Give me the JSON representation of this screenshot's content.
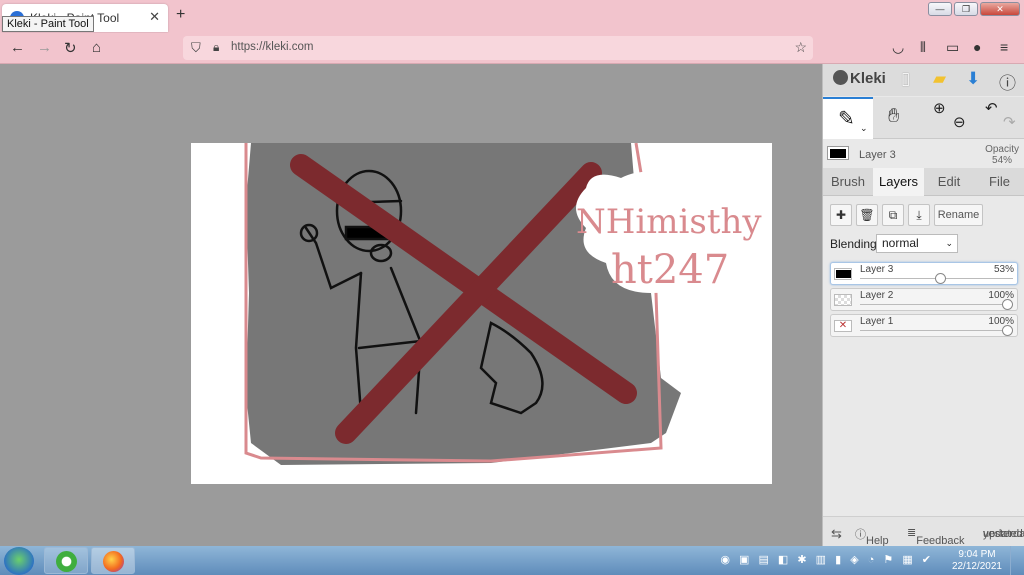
{
  "browser": {
    "tab_title": "Kleki - Paint Tool",
    "tooltip": "Kleki - Paint Tool",
    "url": "https://kleki.com"
  },
  "app": {
    "logo": "Kleki",
    "layer_header": {
      "name": "Layer 3",
      "opacity_label": "Opacity",
      "opacity_value": "54%"
    },
    "tabs": [
      {
        "label": "Brush",
        "active": false
      },
      {
        "label": "Layers",
        "active": true
      },
      {
        "label": "Edit",
        "active": false
      },
      {
        "label": "File",
        "active": false
      }
    ],
    "layer_buttons": {
      "rename": "Rename"
    },
    "blending": {
      "label": "Blending",
      "value": "normal"
    },
    "layers": [
      {
        "name": "Layer 3",
        "opacity": "53%",
        "opacity_fraction": 0.53,
        "active": true
      },
      {
        "name": "Layer 2",
        "opacity": "100%",
        "opacity_fraction": 1.0,
        "active": false
      },
      {
        "name": "Layer 1",
        "opacity": "100%",
        "opacity_fraction": 1.0,
        "active": false
      }
    ],
    "footer": {
      "help": "Help",
      "feedback": "Feedback",
      "updated_line1": "updated",
      "updated_line2": "yesterday"
    }
  },
  "canvas": {
    "artwork_text_line1": "NHimisthy",
    "artwork_text_line2": "ht247"
  },
  "colors": {
    "browser_chrome": "#f2c4cd",
    "x_mark": "#7c2a2e",
    "art_text": "#d98a8e",
    "active_tab_accent": "#2a7fd4"
  },
  "taskbar": {
    "time": "9:04 PM",
    "date": "22/12/2021"
  }
}
